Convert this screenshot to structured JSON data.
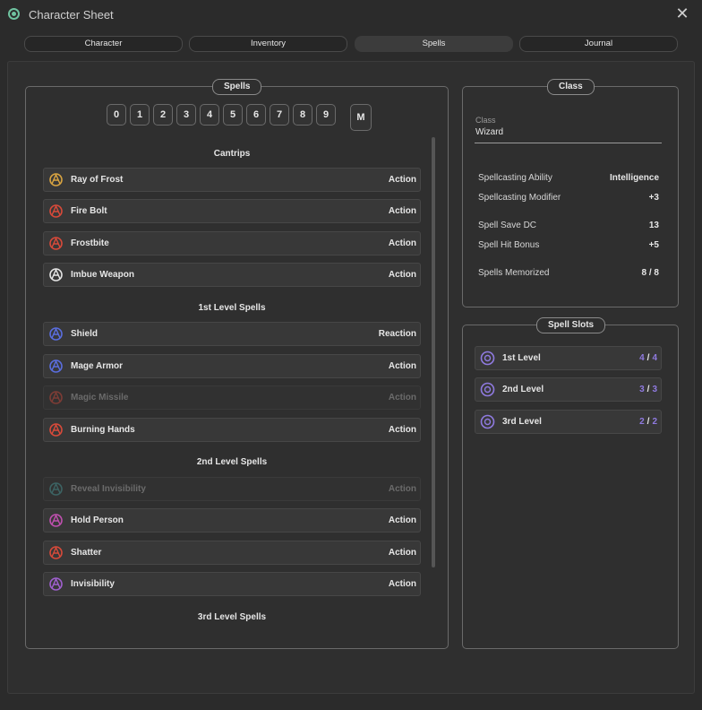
{
  "window": {
    "title": "Character Sheet",
    "close_glyph": "✕"
  },
  "tabs": [
    {
      "label": "Character",
      "active": false
    },
    {
      "label": "Inventory",
      "active": false
    },
    {
      "label": "Spells",
      "active": true
    },
    {
      "label": "Journal",
      "active": false
    }
  ],
  "spells_panel": {
    "title": "Spells",
    "level_filters": [
      "0",
      "1",
      "2",
      "3",
      "4",
      "5",
      "6",
      "7",
      "8",
      "9"
    ],
    "memorized_filter": "M",
    "sections": [
      {
        "heading": "Cantrips"
      },
      {
        "heading": "1st Level Spells"
      },
      {
        "heading": "2nd Level Spells"
      },
      {
        "heading": "3rd Level Spells"
      }
    ],
    "spells": [
      {
        "name": "Ray of Frost",
        "cost": "Action",
        "icon": "ray-of-frost-icon",
        "color": "#d9a441",
        "dim": false
      },
      {
        "name": "Fire Bolt",
        "cost": "Action",
        "icon": "fire-bolt-icon",
        "color": "#d94a3a",
        "dim": false
      },
      {
        "name": "Frostbite",
        "cost": "Action",
        "icon": "frostbite-icon",
        "color": "#d94a3a",
        "dim": false
      },
      {
        "name": "Imbue Weapon",
        "cost": "Action",
        "icon": "imbue-weapon-icon",
        "color": "#e6e6e6",
        "dim": false
      },
      {
        "name": "Shield",
        "cost": "Reaction",
        "icon": "shield-icon",
        "color": "#5a6ee0",
        "dim": false
      },
      {
        "name": "Mage Armor",
        "cost": "Action",
        "icon": "mage-armor-icon",
        "color": "#5a6ee0",
        "dim": false
      },
      {
        "name": "Magic Missile",
        "cost": "Action",
        "icon": "magic-missile-icon",
        "color": "#d94a3a",
        "dim": true
      },
      {
        "name": "Burning Hands",
        "cost": "Action",
        "icon": "burning-hands-icon",
        "color": "#d94a3a",
        "dim": false
      },
      {
        "name": "Reveal Invisibility",
        "cost": "Action",
        "icon": "reveal-invisibility-icon",
        "color": "#4aa0a0",
        "dim": true
      },
      {
        "name": "Hold Person",
        "cost": "Action",
        "icon": "hold-person-icon",
        "color": "#c050b0",
        "dim": false
      },
      {
        "name": "Shatter",
        "cost": "Action",
        "icon": "shatter-icon",
        "color": "#d94a3a",
        "dim": false
      },
      {
        "name": "Invisibility",
        "cost": "Action",
        "icon": "invisibility-icon",
        "color": "#a060d0",
        "dim": false
      }
    ]
  },
  "class_panel": {
    "title": "Class",
    "class_label": "Class",
    "class_value": "Wizard",
    "stats": [
      {
        "key": "Spellcasting Ability",
        "value": "Intelligence"
      },
      {
        "key": "Spellcasting Modifier",
        "value": "+3"
      },
      {
        "key": "Spell Save DC",
        "value": "13"
      },
      {
        "key": "Spell Hit Bonus",
        "value": "+5"
      },
      {
        "key": "Spells Memorized",
        "value": "8 / 8"
      }
    ]
  },
  "slots_panel": {
    "title": "Spell Slots",
    "slots": [
      {
        "label": "1st Level",
        "available": "4",
        "sep": "/",
        "total": "4"
      },
      {
        "label": "2nd Level",
        "available": "3",
        "sep": "/",
        "total": "3"
      },
      {
        "label": "3rd Level",
        "available": "2",
        "sep": "/",
        "total": "2"
      }
    ],
    "accent": "#8f7ae0"
  }
}
